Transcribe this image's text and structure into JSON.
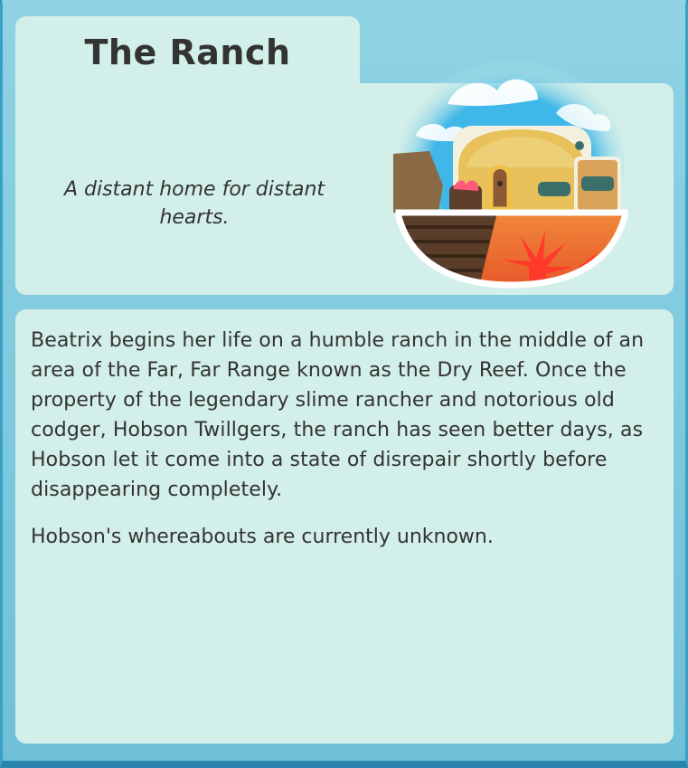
{
  "header": {
    "title": "The Ranch",
    "subtitle": "A distant home for distant hearts."
  },
  "illustration": {
    "icon": "ranch-scene-icon",
    "colors": {
      "sky": "#3fb7e8",
      "dome": "#e9c15a",
      "ground": "#e8672c",
      "plant": "#ff3a2a"
    }
  },
  "description": {
    "paragraphs": [
      "Beatrix begins her life on a humble ranch in the middle of an area of the Far, Far Range known as the Dry Reef. Once the property of the legendary slime rancher and notorious old codger, Hobson Twillgers, the ranch has seen better days, as Hobson let it come into a state of disrepair shortly before disappearing completely.",
      "Hobson's whereabouts are currently unknown."
    ]
  },
  "theme": {
    "panel": "#d3efe9",
    "frame": "#7cc8dd",
    "text": "#333333"
  }
}
